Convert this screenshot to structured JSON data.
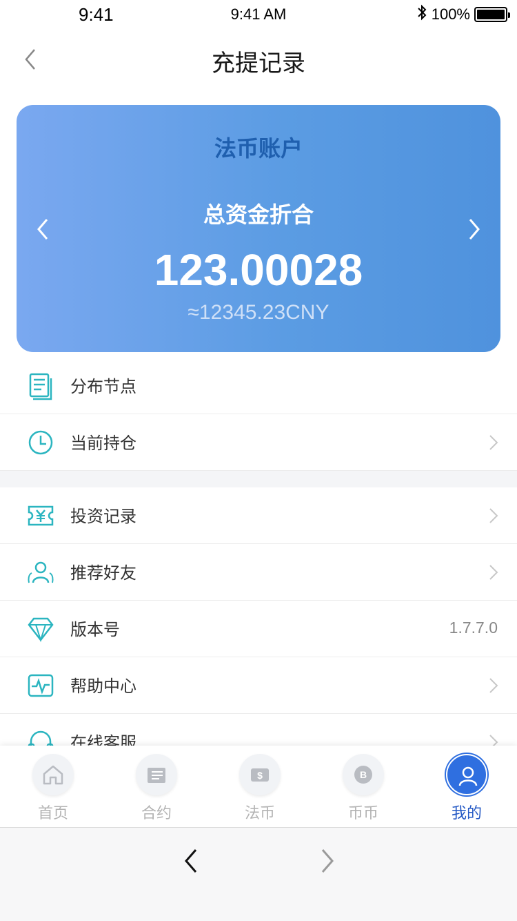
{
  "status_bar": {
    "time_left": "9:41",
    "time_center": "9:41 AM",
    "battery": "100%"
  },
  "nav": {
    "title": "充提记录"
  },
  "account_card": {
    "title": "法币账户",
    "subtitle": "总资金折合",
    "amount": "123.00028",
    "cny": "≈12345.23CNY",
    "gradient_start": "#7aa8f0",
    "gradient_end": "#4f92dd"
  },
  "menu": {
    "items": [
      {
        "label": "分布节点",
        "icon": "document-icon",
        "has_chevron": false
      },
      {
        "label": "当前持仓",
        "icon": "clock-icon",
        "has_chevron": true
      },
      {
        "label": "投资记录",
        "icon": "yuan-ticket-icon",
        "has_chevron": true
      },
      {
        "label": "推荐好友",
        "icon": "friends-icon",
        "has_chevron": true
      },
      {
        "label": "版本号",
        "icon": "diamond-icon",
        "value": "1.7.7.0"
      },
      {
        "label": "帮助中心",
        "icon": "pulse-icon",
        "has_chevron": true
      },
      {
        "label": "在线客服",
        "icon": "headset-icon",
        "has_chevron": true
      }
    ],
    "icon_color": "#2bb5c0"
  },
  "tab_bar": {
    "tabs": [
      {
        "label": "首页",
        "icon": "home-icon",
        "active": false
      },
      {
        "label": "合约",
        "icon": "contract-icon",
        "active": false
      },
      {
        "label": "法币",
        "icon": "dollar-icon",
        "active": false
      },
      {
        "label": "币币",
        "icon": "bitcoin-icon",
        "active": false
      },
      {
        "label": "我的",
        "icon": "user-icon",
        "active": true
      }
    ],
    "active_color": "#2f6fe0"
  }
}
